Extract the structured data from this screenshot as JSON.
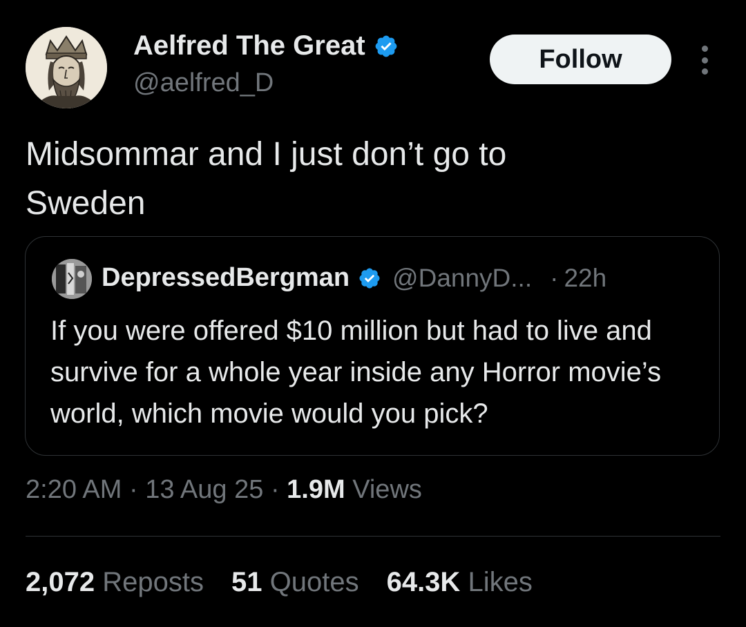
{
  "author": {
    "name": "Aelfred The Great",
    "handle": "@aelfred_D",
    "verified": true
  },
  "follow_label": "Follow",
  "more_icon": "more-dots-vertical",
  "tweet": {
    "text_line1": "Midsommar and I just don’t go to",
    "text_line2": "Sweden"
  },
  "quote": {
    "name": "DepressedBergman",
    "handle": "@DannyD...",
    "separator": "·",
    "time": "22h",
    "text": "If you were offered $10 million but had to live and survive for a whole year inside any Horror movie’s world, which movie would you pick?"
  },
  "meta": {
    "time": "2:20 AM",
    "sep1": "·",
    "date": "13 Aug 25",
    "sep2": "·",
    "views_count": "1.9M",
    "views_label": "Views"
  },
  "stats": {
    "reposts_count": "2,072",
    "reposts_label": "Reposts",
    "quotes_count": "51",
    "quotes_label": "Quotes",
    "likes_count": "64.3K",
    "likes_label": "Likes"
  },
  "colors": {
    "background": "#000000",
    "text_primary": "#e7e9ea",
    "text_secondary": "#71767b",
    "verified_blue": "#1d9bf0",
    "border": "#2f3336",
    "follow_bg": "#eff3f4"
  }
}
